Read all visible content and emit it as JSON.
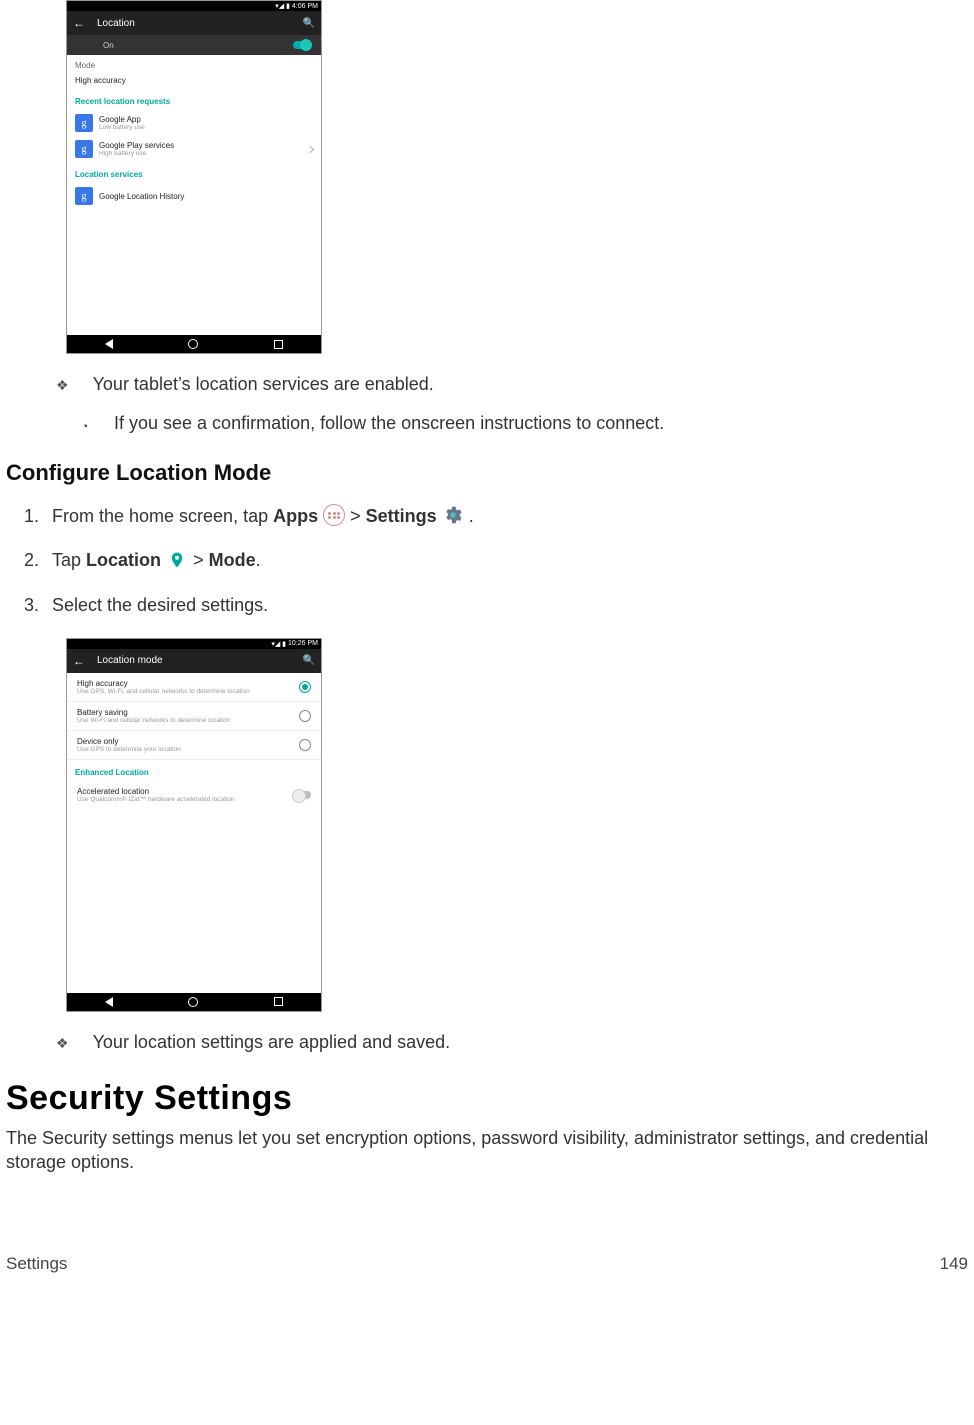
{
  "screenshot1": {
    "status_time": "4:06 PM",
    "status_icons": "▾◢ ▮",
    "appbar_title": "Location",
    "toggle_label": "On",
    "mode_section": "Mode",
    "mode_value": "High accuracy",
    "recent_section": "Recent location requests",
    "items": [
      {
        "icon": "g",
        "label": "Google App",
        "sub": "Low battery use"
      },
      {
        "icon": "g",
        "label": "Google Play services",
        "sub": "High battery use"
      }
    ],
    "services_section": "Location services",
    "service": {
      "icon": "g",
      "label": "Google Location History"
    }
  },
  "note1": "Your tablet’s location services are enabled.",
  "note1_sub": "If you see a confirmation, follow the onscreen instructions to connect.",
  "configure_heading": "Configure Location Mode",
  "steps": {
    "s1_pre": "From the home screen, tap ",
    "s1_apps": "Apps",
    "s1_mid": " > ",
    "s1_settings": "Settings",
    "s1_end": " .",
    "s2_pre": "Tap ",
    "s2_loc": "Location",
    "s2_mid": " > ",
    "s2_mode": "Mode",
    "s2_end": ".",
    "s3": "Select the desired settings."
  },
  "screenshot2": {
    "status_time": "10:26 PM",
    "status_icons": "▾◢ ▮",
    "appbar_title": "Location mode",
    "options": [
      {
        "label": "High accuracy",
        "sub": "Use GPS, Wi-Fi, and cellular networks to determine location",
        "selected": true
      },
      {
        "label": "Battery saving",
        "sub": "Use Wi-Fi and cellular networks to determine location",
        "selected": false
      },
      {
        "label": "Device only",
        "sub": "Use GPS to determine your location",
        "selected": false
      }
    ],
    "enhanced_section": "Enhanced Location",
    "enhanced": {
      "label": "Accelerated location",
      "sub": "Use Qualcomm® IZat™ hardware accelerated location"
    }
  },
  "note2": "Your location settings are applied and saved.",
  "security_heading": "Security Settings",
  "security_para": "The Security settings menus let you set encryption options, password visibility, administrator settings, and credential storage options.",
  "footer_left": "Settings",
  "footer_right": "149"
}
